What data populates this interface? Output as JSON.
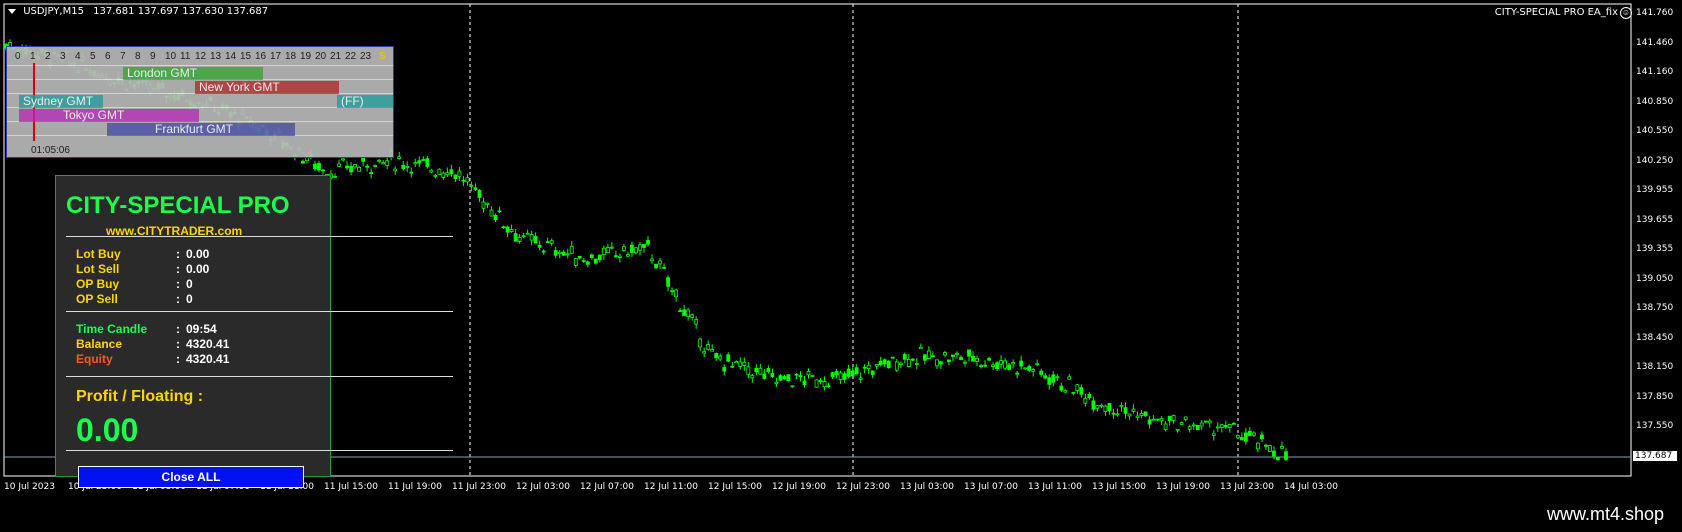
{
  "header": {
    "symbol": "USDJPY,M15",
    "ohlc": "137.681 137.697 137.630 137.687",
    "ea_name": "CITY-SPECIAL PRO EA_fix",
    "smiley": "☺"
  },
  "price_axis": [
    "141.760",
    "141.460",
    "141.160",
    "140.850",
    "140.550",
    "140.250",
    "139.955",
    "139.655",
    "139.355",
    "139.050",
    "138.750",
    "138.450",
    "138.150",
    "137.850",
    "137.550"
  ],
  "current_price": "137.687",
  "time_axis": [
    "10 Jul 2023",
    "10 Jul 23:00",
    "11 Jul 03:00",
    "11 Jul 07:00",
    "11 Jul 11:00",
    "11 Jul 15:00",
    "11 Jul 19:00",
    "11 Jul 23:00",
    "12 Jul 03:00",
    "12 Jul 07:00",
    "12 Jul 11:00",
    "12 Jul 15:00",
    "12 Jul 19:00",
    "12 Jul 23:00",
    "13 Jul 03:00",
    "13 Jul 07:00",
    "13 Jul 11:00",
    "13 Jul 15:00",
    "13 Jul 19:00",
    "13 Jul 23:00",
    "14 Jul 03:00"
  ],
  "sessions": {
    "hours": [
      "0",
      "1",
      "2",
      "3",
      "4",
      "5",
      "6",
      "7",
      "8",
      "9",
      "10",
      "11",
      "12",
      "13",
      "14",
      "15",
      "16",
      "17",
      "18",
      "19",
      "20",
      "21",
      "22",
      "23"
    ],
    "s_label": "S",
    "london": "London GMT",
    "newyork": "New York GMT",
    "sydney": "Sydney GMT",
    "ff": "(FF)",
    "tokyo": "Tokyo GMT",
    "frankfurt": "Frankfurt GMT",
    "clock": "01:05:06"
  },
  "ea": {
    "title": "CITY-SPECIAL PRO",
    "url": "www.CITYTRADER.com",
    "rows1": [
      {
        "k": "Lot Buy",
        "v": "0.00"
      },
      {
        "k": "Lot Sell",
        "v": "0.00"
      },
      {
        "k": "OP Buy",
        "v": "0"
      },
      {
        "k": "OP Sell",
        "v": "0"
      }
    ],
    "time_candle": {
      "k": "Time Candle",
      "v": "09:54"
    },
    "balance": {
      "k": "Balance",
      "v": "4320.41"
    },
    "equity": {
      "k": "Equity",
      "v": "4320.41"
    },
    "colon": ":",
    "profit_label": "Profit / Floating  :",
    "profit_value": "0.00",
    "close_all": "Close ALL"
  },
  "footer": {
    "brand": "www.mt4.shop"
  },
  "colors": {
    "candle": "#00ff00",
    "background": "#000000",
    "dotted": "#ffffff"
  },
  "chart_data": {
    "type": "line",
    "x_range": [
      "10 Jul 2023",
      "14 Jul 03:00"
    ],
    "ylim": [
      137.55,
      141.76
    ],
    "x": [
      "10 Jul 2023",
      "10 Jul 23:00",
      "11 Jul 03:00",
      "11 Jul 07:00",
      "11 Jul 11:00",
      "11 Jul 15:00",
      "11 Jul 19:00",
      "11 Jul 23:00",
      "12 Jul 03:00",
      "12 Jul 07:00",
      "12 Jul 11:00",
      "12 Jul 15:00",
      "12 Jul 19:00",
      "12 Jul 23:00",
      "13 Jul 03:00",
      "13 Jul 07:00",
      "13 Jul 11:00",
      "13 Jul 15:00",
      "13 Jul 19:00",
      "13 Jul 23:00",
      "14 Jul 03:00"
    ],
    "values": [
      141.46,
      141.3,
      141.1,
      140.95,
      140.7,
      140.3,
      140.4,
      140.3,
      139.7,
      139.5,
      139.6,
      138.6,
      138.4,
      138.4,
      138.6,
      138.6,
      138.5,
      138.2,
      138.0,
      137.95,
      137.69
    ]
  }
}
